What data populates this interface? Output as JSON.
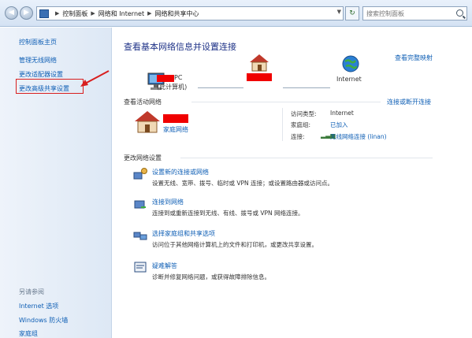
{
  "address_bar": {
    "crumbs": [
      "控制面板",
      "网络和 Internet",
      "网络和共享中心"
    ],
    "search_placeholder": "搜索控制面板"
  },
  "sidebar": {
    "items": [
      {
        "label": "控制面板主页"
      },
      {
        "label": "管理无线网络"
      },
      {
        "label": "更改适配器设置"
      },
      {
        "label": "更改高级共享设置"
      }
    ],
    "see_also_title": "另请参阅",
    "see_also": [
      {
        "label": "Internet 选项"
      },
      {
        "label": "Windows 防火墙"
      },
      {
        "label": "家庭组"
      }
    ]
  },
  "main": {
    "heading": "查看基本网络信息并设置连接",
    "full_map_link": "查看完整映射",
    "map": {
      "computer_suffix": "PC",
      "computer_sub": "(此计算机)",
      "internet_label": "Internet"
    },
    "active_networks_title": "查看活动网络",
    "connect_link": "连接或断开连接",
    "network": {
      "type_link": "家庭网络",
      "access_type_label": "访问类型:",
      "access_type_value": "Internet",
      "homegroup_label": "家庭组:",
      "homegroup_value": "已加入",
      "connection_label": "连接:",
      "connection_value": "无线网络连接 (linan)"
    },
    "change_settings_title": "更改网络设置",
    "options": [
      {
        "title": "设置新的连接或网络",
        "desc": "设置无线、宽带、拨号、临时或 VPN 连接；或设置路由器或访问点。"
      },
      {
        "title": "连接到网络",
        "desc": "连接到或重新连接到无线、有线、拨号或 VPN 网络连接。"
      },
      {
        "title": "选择家庭组和共享选项",
        "desc": "访问位于其他网络计算机上的文件和打印机，或更改共享设置。"
      },
      {
        "title": "疑难解答",
        "desc": "诊断并修复网络问题，或获得故障排除信息。"
      }
    ]
  },
  "colors": {
    "link": "#0f5fb5",
    "heading": "#1e3287",
    "redaction": "#f00000",
    "annotation": "#d81e1e"
  }
}
